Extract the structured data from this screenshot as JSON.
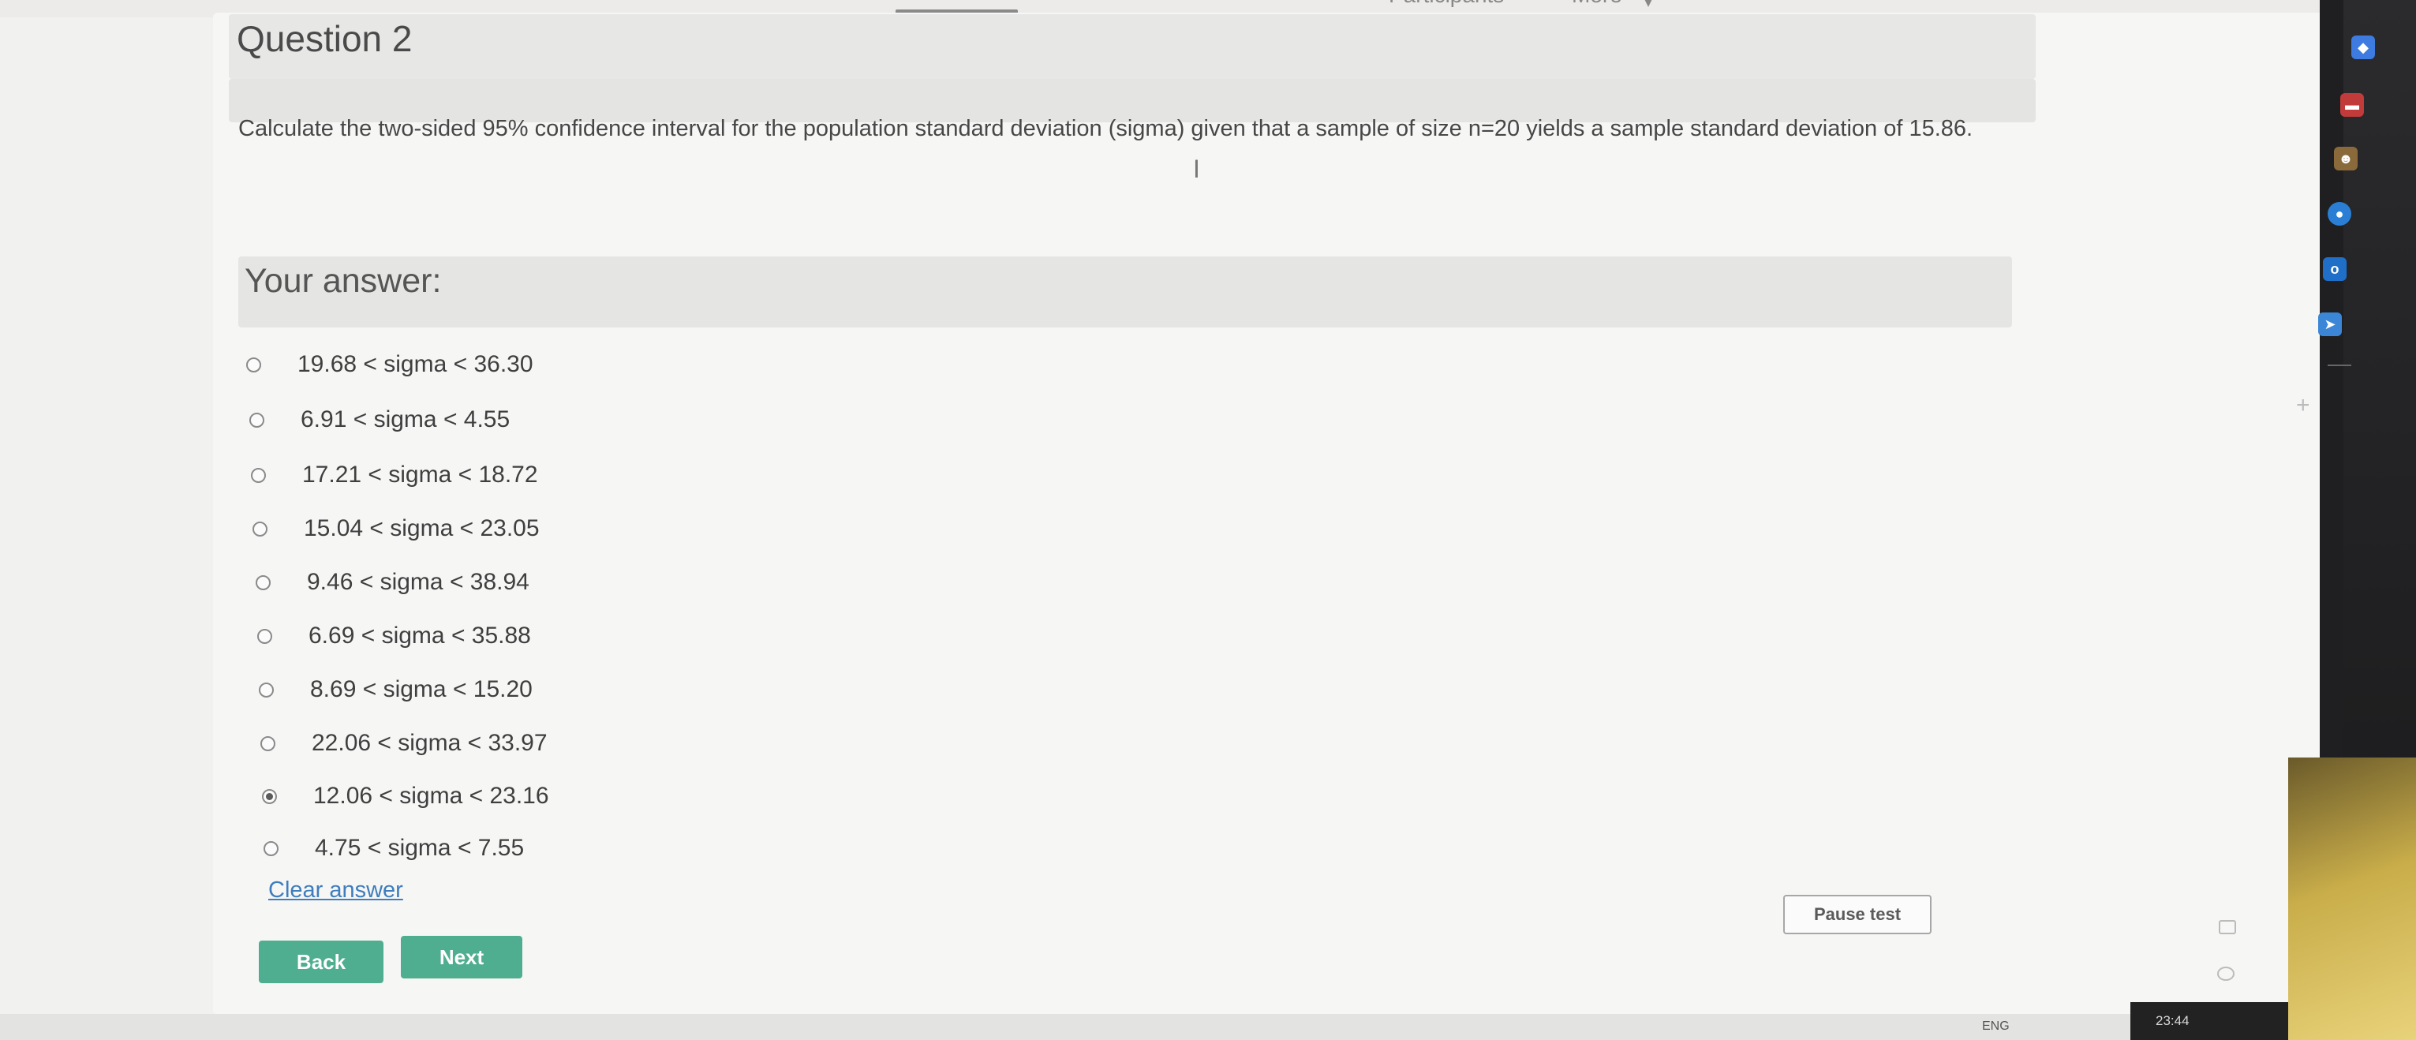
{
  "top_bar": {
    "participants": "Participants",
    "more": "More"
  },
  "question": {
    "title": "Question 2",
    "text": "Calculate the two-sided 95% confidence interval for the population standard deviation (sigma) given that a sample of size n=20 yields a sample standard deviation of 15.86."
  },
  "answer": {
    "heading": "Your answer:",
    "options": [
      {
        "label": "19.68 < sigma < 36.30",
        "selected": false
      },
      {
        "label": "6.91 < sigma < 4.55",
        "selected": false
      },
      {
        "label": "17.21 < sigma < 18.72",
        "selected": false
      },
      {
        "label": "15.04 < sigma < 23.05",
        "selected": false
      },
      {
        "label": "9.46 < sigma < 38.94",
        "selected": false
      },
      {
        "label": "6.69 < sigma < 35.88",
        "selected": false
      },
      {
        "label": "8.69 < sigma < 15.20",
        "selected": false
      },
      {
        "label": "22.06 < sigma < 33.97",
        "selected": false
      },
      {
        "label": "12.06 < sigma < 23.16",
        "selected": true
      },
      {
        "label": "4.75 < sigma < 7.55",
        "selected": false
      }
    ],
    "clear_label": "Clear answer"
  },
  "buttons": {
    "back": "Back",
    "next": "Next",
    "pause": "Pause test"
  },
  "taskbar": {
    "lang": "ENG",
    "clock": "23:44"
  },
  "colors": {
    "accent_button": "#4fae90",
    "link": "#3f7dbd"
  }
}
